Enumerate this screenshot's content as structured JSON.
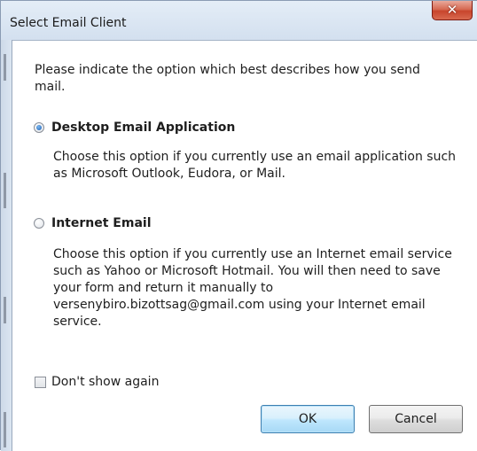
{
  "window": {
    "title": "Select Email Client",
    "close_glyph": "✕"
  },
  "dialog": {
    "intro": "Please indicate the option which best describes how you send mail.",
    "options": [
      {
        "label": "Desktop Email Application",
        "selected": true,
        "description": "Choose this option if you currently use an email application such as Microsoft Outlook, Eudora, or Mail."
      },
      {
        "label": "Internet Email",
        "selected": false,
        "description": "Choose this option if you currently use an Internet email service such as Yahoo or Microsoft Hotmail. You will then need to save your form and return it manually to versenybiro.bizottsag@gmail.com using your Internet email service."
      }
    ],
    "dont_show_again": {
      "label": "Don't show again",
      "checked": false
    },
    "buttons": {
      "ok": "OK",
      "cancel": "Cancel"
    }
  },
  "colors": {
    "frame": "#d7e3f1",
    "close_button": "#c8452c",
    "radio_selected": "#1f5fb3",
    "ok_border": "#3c7fb1"
  }
}
